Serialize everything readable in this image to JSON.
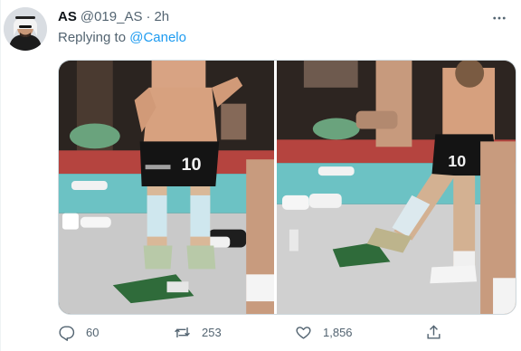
{
  "tweet": {
    "display_name": "AS",
    "handle": "@019_AS",
    "separator": "·",
    "time": "2h",
    "replying_prefix": "Replying to",
    "replying_to": "@Canelo",
    "jersey_number": "10"
  },
  "actions": {
    "replies": "60",
    "retweets": "253",
    "likes": "1,856"
  },
  "icons": {
    "more": "more-horizontal-icon",
    "reply": "reply-icon",
    "retweet": "retweet-icon",
    "like": "heart-icon",
    "share": "share-icon"
  },
  "colors": {
    "link": "#1d9bf0",
    "secondary_text": "#536471",
    "primary_text": "#0f1419"
  }
}
